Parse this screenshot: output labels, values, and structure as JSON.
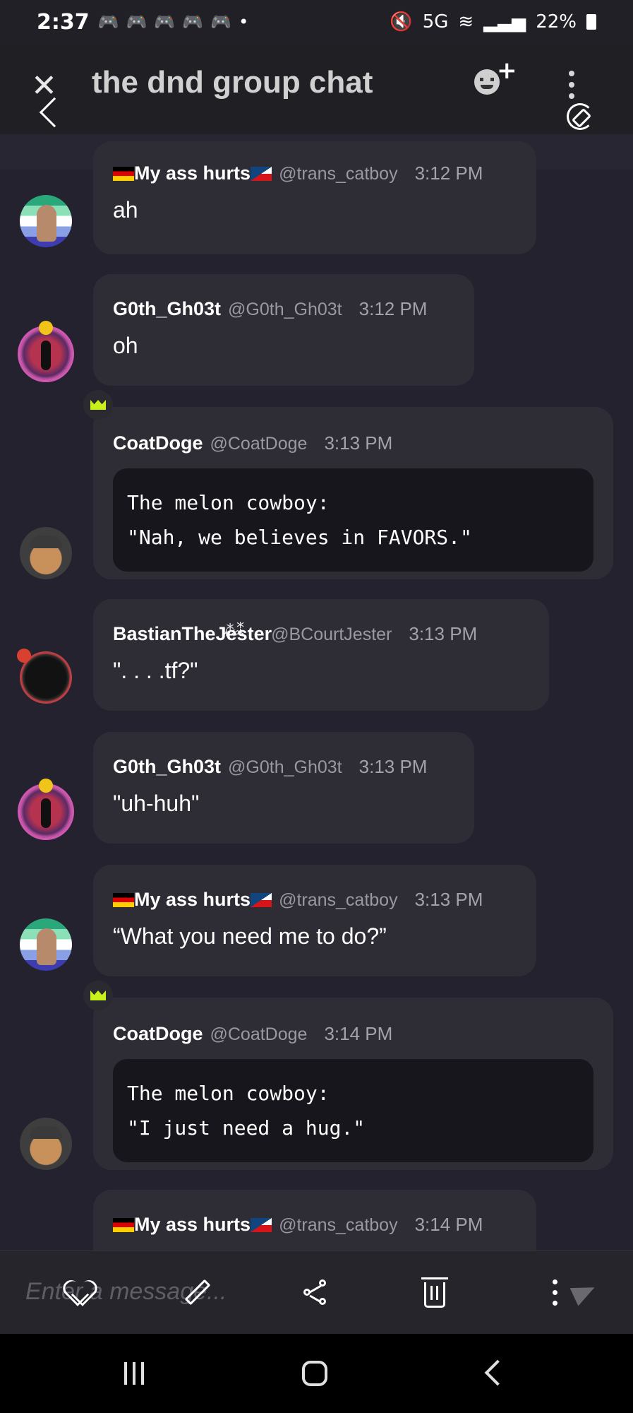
{
  "status_bar": {
    "time": "2:37",
    "notification_icons": [
      "discord-icon",
      "discord-icon",
      "discord-icon",
      "discord-icon",
      "discord-icon"
    ],
    "dot": "•",
    "network": "5G",
    "battery": "22%"
  },
  "header": {
    "title": "the dnd group chat"
  },
  "messages": [
    {
      "name": "My ass hurts",
      "flags": [
        "de",
        "cz"
      ],
      "handle": "@trans_catboy",
      "time": "3:12 PM",
      "text": "ah",
      "avatar": "trans-flag-avatar"
    },
    {
      "name": "G0th_Gh03t",
      "handle": "@G0th_Gh03t",
      "time": "3:12 PM",
      "text": "oh",
      "avatar": "ghost-avatar"
    },
    {
      "name": "CoatDoge",
      "handle": "@CoatDoge",
      "time": "3:13 PM",
      "code": "The melon cowboy:\n\"Nah, we believes in FAVORS.\"",
      "avatar": "doge-avatar",
      "crown": true
    },
    {
      "name": "BastianTheJester",
      "handle": "@BCourtJester",
      "time": "3:13 PM",
      "text": "\". .  . .tf?\"",
      "avatar": "jester-avatar"
    },
    {
      "name": "G0th_Gh03t",
      "handle": "@G0th_Gh03t",
      "time": "3:13 PM",
      "text": "\"uh-huh\"",
      "avatar": "ghost-avatar"
    },
    {
      "name": "My ass hurts",
      "flags": [
        "de",
        "cz"
      ],
      "handle": "@trans_catboy",
      "time": "3:13 PM",
      "text": "“What you need me to do?”",
      "avatar": "trans-flag-avatar"
    },
    {
      "name": "CoatDoge",
      "handle": "@CoatDoge",
      "time": "3:14 PM",
      "code": "The melon cowboy:\n\"I just need a hug.\"",
      "avatar": "doge-avatar",
      "crown": true
    },
    {
      "name": "My ass hurts",
      "flags": [
        "de",
        "cz"
      ],
      "handle": "@trans_catboy",
      "time": "3:14 PM",
      "text": "",
      "avatar": "trans-flag-avatar"
    }
  ],
  "composer": {
    "placeholder": "Enter a message..."
  },
  "colors": {
    "background": "#24222f",
    "bubble": "#2e2d35",
    "code_block": "#17161d",
    "crown": "#c8f01a",
    "muted_text": "#9a99a2"
  }
}
